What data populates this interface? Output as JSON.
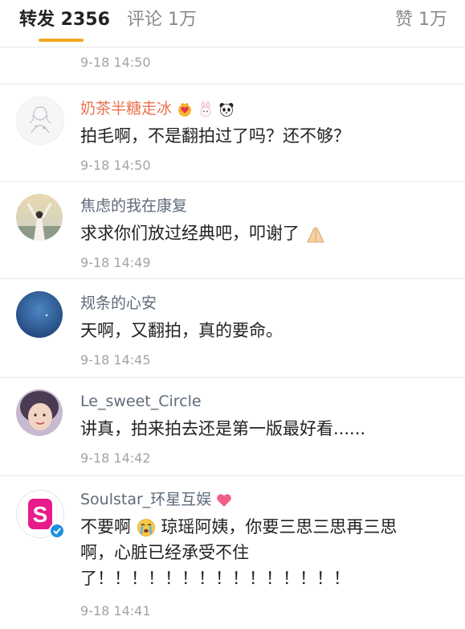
{
  "tabs": {
    "forward": "转发 2356",
    "comment": "评论 1万",
    "like": "赞 1万"
  },
  "colors": {
    "accent": "#f5a623",
    "name_orange": "#eb7350",
    "name_gray": "#5f6b7a",
    "time": "#a3a3a3"
  },
  "comments": [
    {
      "time": "9-18 14:50"
    },
    {
      "name": "奶茶半糖走冰",
      "badges": [
        "crown-heart-icon",
        "rabbit-icon",
        "panda-icon"
      ],
      "text": "拍毛啊，不是翻拍过了吗？还不够？",
      "time": "9-18 14:50"
    },
    {
      "name": "焦虑的我在康复",
      "text": "求求你们放过经典吧，叩谢了",
      "text_icon": "praying-hands-icon",
      "time": "9-18 14:49"
    },
    {
      "name": "规条的心安",
      "text": "天啊，又翻拍，真的要命。",
      "time": "9-18 14:45"
    },
    {
      "name": "Le_sweet_Circle",
      "text": "讲真，拍来拍去还是第一版最好看......",
      "time": "9-18 14:42"
    },
    {
      "name": "Soulstar_环星互娱",
      "name_icon": "heart-icon",
      "avatar_letter": "S",
      "verified_icon": "verified-check-icon",
      "text_a": "不要啊",
      "text_icon": "crying-face-icon",
      "text_b": "琼瑶阿姨，你要三思三思再三思",
      "text_line2": "啊，心脏已经承受不住",
      "text_line3": "了！！！！！！！！！！！！！！！",
      "time": "9-18 14:41"
    }
  ]
}
